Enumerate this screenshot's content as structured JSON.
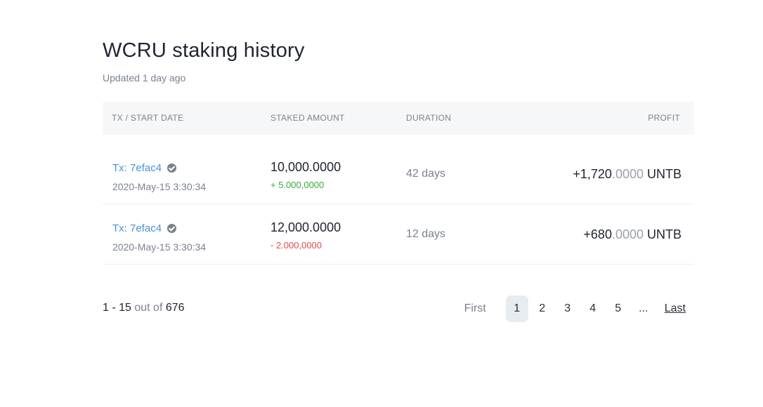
{
  "header": {
    "title": "WCRU staking history",
    "updated": "Updated 1 day ago"
  },
  "table": {
    "columns": [
      "TX / START DATE",
      "STAKED AMOUNT",
      "DURATION",
      "PROFIT"
    ],
    "rows": [
      {
        "tx": "Tx: 7efac4",
        "date": "2020-May-15 3:30:34",
        "amount": "10,000.0000",
        "delta": "+ 5.000,0000",
        "delta_sign": "positive",
        "duration": "42 days",
        "profit_int": "+1,720",
        "profit_dec": ".0000",
        "profit_unit": " UNTB"
      },
      {
        "tx": "Tx: 7efac4",
        "date": "2020-May-15 3:30:34",
        "amount": "12,000.0000",
        "delta": "- 2.000,0000",
        "delta_sign": "negative",
        "duration": "12 days",
        "profit_int": "+680",
        "profit_dec": ".0000",
        "profit_unit": " UNTB"
      }
    ]
  },
  "pagination": {
    "range": "1 - 15",
    "out_of": " out of ",
    "total": "676",
    "first": "First",
    "pages": [
      "1",
      "2",
      "3",
      "4",
      "5"
    ],
    "active_page": "1",
    "ellipsis": "...",
    "last": "Last"
  },
  "colors": {
    "link": "#4a90d9",
    "positive": "#3aaa3a",
    "negative": "#e04b4b",
    "header_bg": "#f6f7f9",
    "active_page_bg": "#e8ecf0"
  },
  "icons": {
    "verified": "verified-check-icon"
  }
}
